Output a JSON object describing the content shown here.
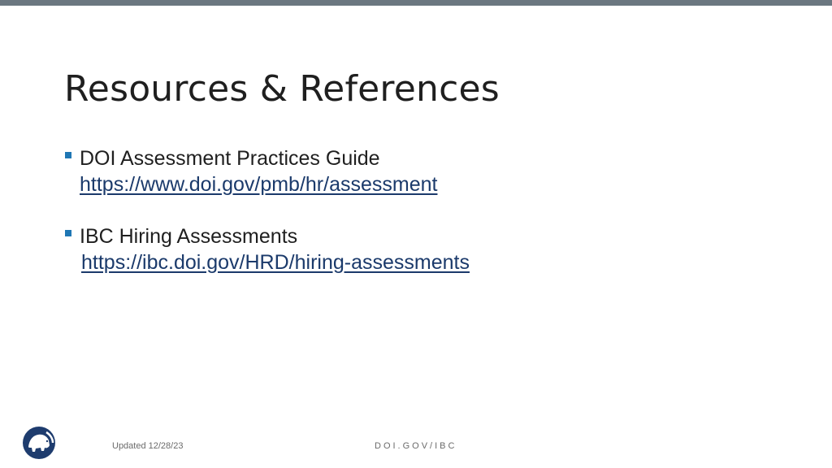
{
  "slide": {
    "title": "Resources & References",
    "bullets": [
      {
        "label": "DOI Assessment Practices Guide",
        "link": "https://www.doi.gov/pmb/hr/assessment"
      },
      {
        "label": "IBC Hiring Assessments",
        "link": "https://ibc.doi.gov/HRD/hiring-assessments"
      }
    ]
  },
  "footer": {
    "updated": "Updated 12/28/23",
    "site": "DOI.GOV/IBC"
  },
  "colors": {
    "top_bar": "#6b7780",
    "bullet_marker": "#1f77b4",
    "link": "#1b3a6b",
    "logo": "#1e3c6e"
  },
  "icons": {
    "logo": "doi-bison-logo-icon"
  }
}
